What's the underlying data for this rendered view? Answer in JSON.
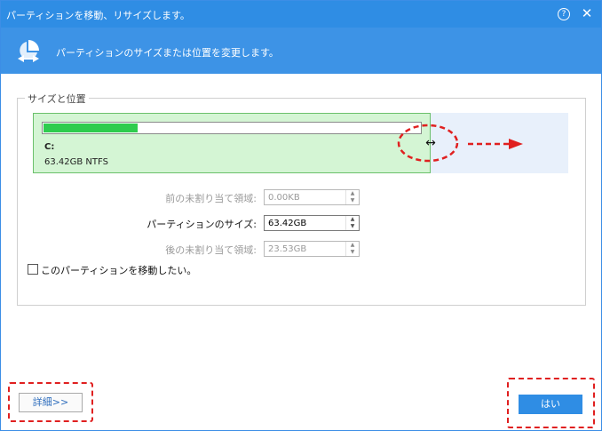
{
  "window": {
    "title": "パーティションを移動、リサイズします。",
    "help_glyph": "?",
    "close_glyph": "✕"
  },
  "banner": {
    "icon": "partition-resize-icon",
    "text": "パーティションのサイズまたは位置を変更します。"
  },
  "group": {
    "title": "サイズと位置"
  },
  "partition": {
    "letter": "C:",
    "info": "63.42GB NTFS",
    "used_fraction": 0.25,
    "fill_color": "#2ecc4e",
    "background_color": "#d4f5d4"
  },
  "fields": {
    "before_label": "前の未割り当て領域:",
    "before_value": "0.00KB",
    "size_label": "パーティションのサイズ:",
    "size_value": "63.42GB",
    "after_label": "後の未割り当て領域:",
    "after_value": "23.53GB"
  },
  "move_checkbox": {
    "label": "このパーティションを移動したい。",
    "checked": false
  },
  "buttons": {
    "detail_label": "詳細>>",
    "yes_label": "はい"
  },
  "colors": {
    "accent": "#2f8de4",
    "annotation": "#e02020"
  },
  "icons": {
    "resize_cursor": "↔"
  }
}
